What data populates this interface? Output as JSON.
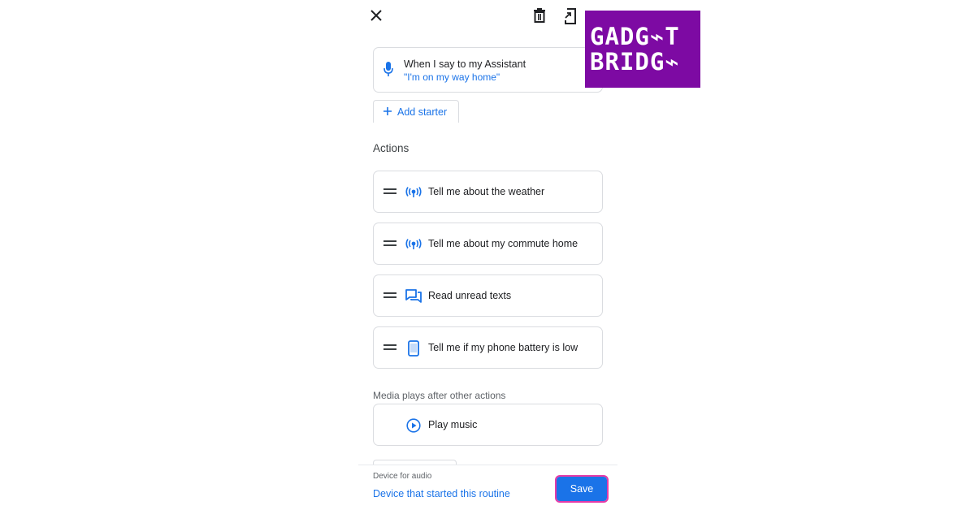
{
  "topbar": {
    "close_icon": "close-icon",
    "delete_icon": "trash-icon",
    "shortcut_icon": "add-to-home-icon"
  },
  "starter": {
    "title": "When I say to my Assistant",
    "phrase": "\"I'm on my way home\"",
    "icon": "mic-icon",
    "add_label": "Add starter"
  },
  "actions": {
    "title": "Actions",
    "items": [
      {
        "label": "Tell me about the weather",
        "icon": "broadcast-icon"
      },
      {
        "label": "Tell me about my commute home",
        "icon": "broadcast-icon"
      },
      {
        "label": "Read unread texts",
        "icon": "chat-icon"
      },
      {
        "label": "Tell me if my phone battery is low",
        "icon": "phone-icon"
      }
    ]
  },
  "media": {
    "note": "Media plays after other actions",
    "item": {
      "label": "Play music",
      "icon": "play-circle-icon"
    }
  },
  "footer": {
    "device_caption": "Device for audio",
    "device_link": "Device that started this routine",
    "save_label": "Save"
  },
  "logo": {
    "line1": "GADG⌁T",
    "line2": "BRIDG⌁"
  },
  "colors": {
    "accent": "#1a73e8",
    "highlight": "#e53aa8",
    "logo_bg": "#7d0aa3"
  }
}
